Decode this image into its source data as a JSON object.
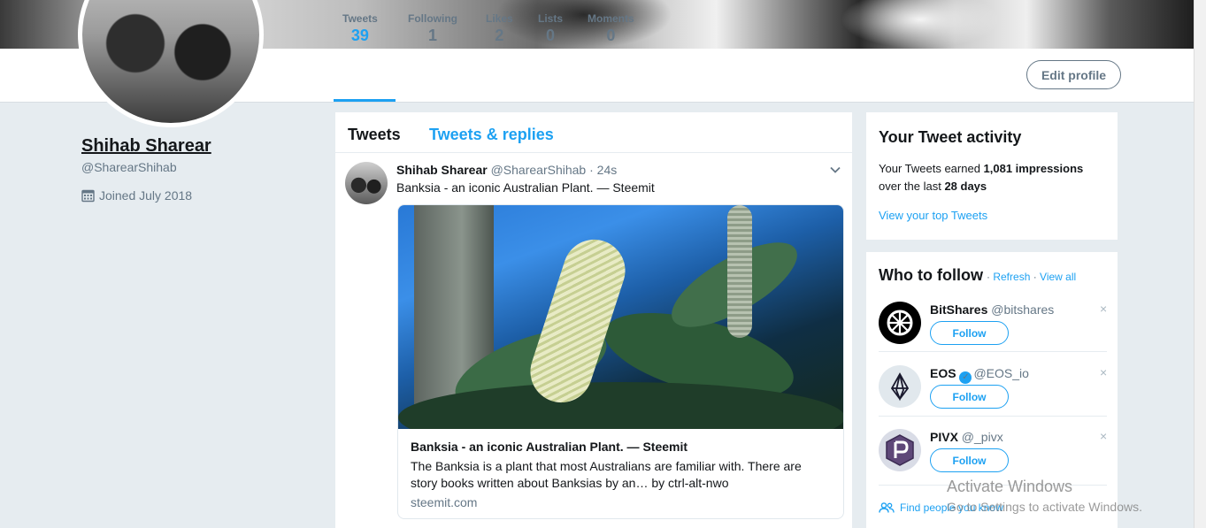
{
  "nav": {
    "items": [
      {
        "label": "Tweets",
        "count": "39"
      },
      {
        "label": "Following",
        "count": "1"
      },
      {
        "label": "Likes",
        "count": "2"
      },
      {
        "label": "Lists",
        "count": "0"
      },
      {
        "label": "Moments",
        "count": "0"
      }
    ],
    "edit_profile": "Edit profile"
  },
  "profile": {
    "name": "Shihab Sharear",
    "handle": "@SharearShihab",
    "joined": "Joined July 2018",
    "joined_icon": "calendar-icon"
  },
  "timeline": {
    "tabs": [
      "Tweets",
      "Tweets & replies"
    ],
    "tweet": {
      "name": "Shihab Sharear",
      "handle": "@SharearShihab",
      "time": "· 24s",
      "text": "Banksia - an iconic Australian Plant. — Steemit",
      "card": {
        "title": "Banksia - an iconic Australian Plant. — Steemit",
        "description": "The Banksia is a plant that most Australians are familiar with. There are story books written about Banksias by an… by ctrl-alt-nwo",
        "domain": "steemit.com"
      }
    }
  },
  "activity": {
    "title": "Your Tweet activity",
    "text_pre": "Your Tweets earned ",
    "impressions": "1,081 impressions",
    "text_mid": "over the last ",
    "period": "28 days",
    "link": "View your top Tweets"
  },
  "who_to_follow": {
    "title": "Who to follow",
    "sep1": " · ",
    "refresh": "Refresh",
    "sep2": " · ",
    "view_all": "View all",
    "accounts": [
      {
        "name": "BitShares",
        "handle": "@bitshares",
        "verified": false,
        "follow": "Follow",
        "dismiss": "×"
      },
      {
        "name": "EOS",
        "handle": "@EOS_io",
        "verified": true,
        "follow": "Follow",
        "dismiss": "×"
      },
      {
        "name": "PIVX",
        "handle": "@_pivx",
        "verified": false,
        "follow": "Follow",
        "dismiss": "×"
      }
    ],
    "find_people": "Find people you know"
  },
  "watermark": {
    "line1": "Activate Windows",
    "line2": "Go to Settings to activate Windows."
  },
  "colors": {
    "accent": "#1da1f2",
    "secondary_text": "#657786",
    "background": "#e6ecf0"
  }
}
